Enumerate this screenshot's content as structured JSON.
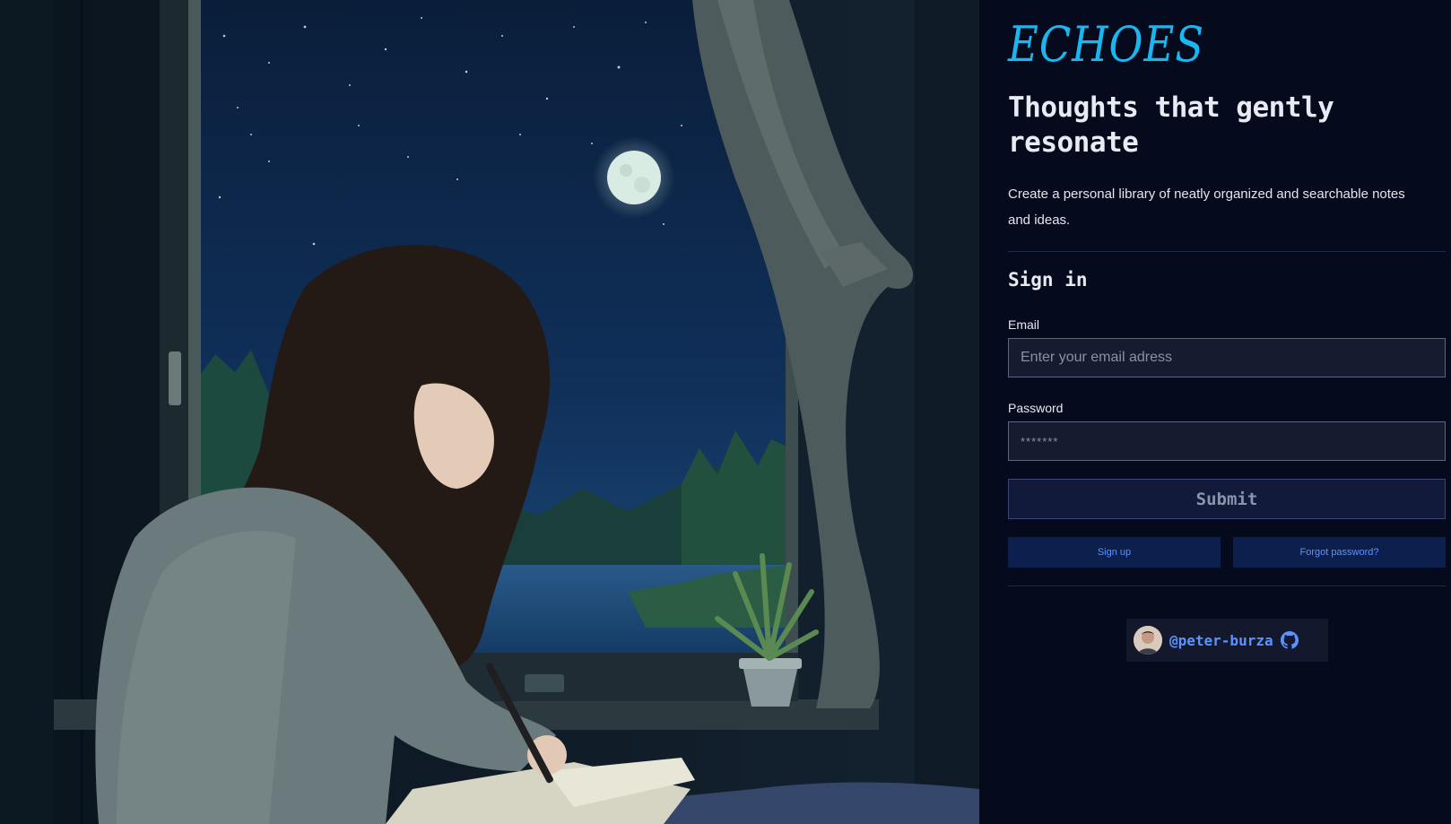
{
  "brand": {
    "logo": "ECHOES",
    "tagline": "Thoughts that gently resonate",
    "description": "Create a personal library of neatly organized and searchable notes and ideas."
  },
  "signin": {
    "title": "Sign in",
    "email_label": "Email",
    "email_placeholder": "Enter your email adress",
    "password_label": "Password",
    "password_placeholder": "*******",
    "submit_label": "Submit",
    "signup_label": "Sign up",
    "forgot_label": "Forgot password?"
  },
  "credit": {
    "handle": "@peter-burza",
    "icon": "github-icon"
  },
  "colors": {
    "accent": "#19b7f0",
    "link": "#5c93ff",
    "background": "#050a1c"
  }
}
